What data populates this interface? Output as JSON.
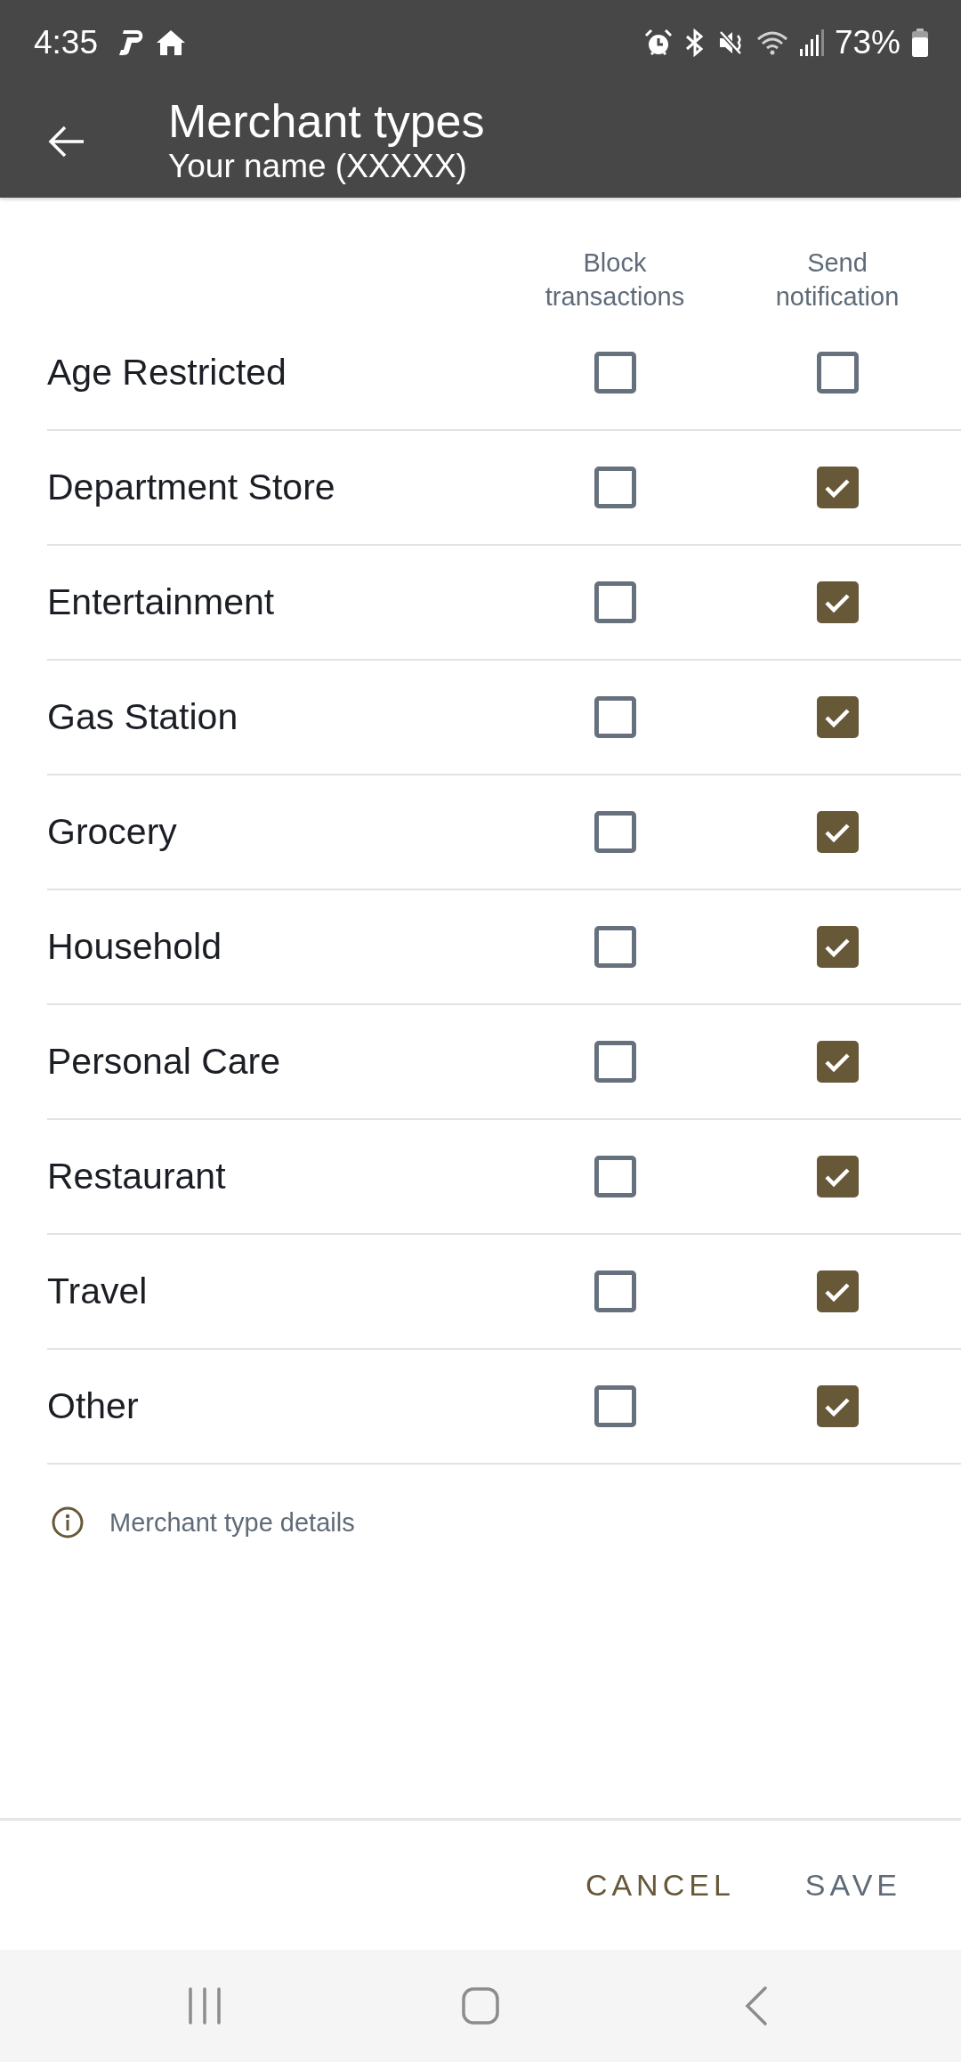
{
  "status_bar": {
    "time": "4:35",
    "battery": "73%"
  },
  "app_bar": {
    "title": "Merchant types",
    "subtitle": "Your name (XXXXX)"
  },
  "columns": [
    "Block transactions",
    "Send notification"
  ],
  "rows": [
    {
      "label": "Age Restricted",
      "block_checked": false,
      "notify_checked": false
    },
    {
      "label": "Department Store",
      "block_checked": false,
      "notify_checked": true
    },
    {
      "label": "Entertainment",
      "block_checked": false,
      "notify_checked": true
    },
    {
      "label": "Gas Station",
      "block_checked": false,
      "notify_checked": true
    },
    {
      "label": "Grocery",
      "block_checked": false,
      "notify_checked": true
    },
    {
      "label": "Household",
      "block_checked": false,
      "notify_checked": true
    },
    {
      "label": "Personal Care",
      "block_checked": false,
      "notify_checked": true
    },
    {
      "label": "Restaurant",
      "block_checked": false,
      "notify_checked": true
    },
    {
      "label": "Travel",
      "block_checked": false,
      "notify_checked": true
    },
    {
      "label": "Other",
      "block_checked": false,
      "notify_checked": true
    }
  ],
  "details_link": "Merchant type details",
  "buttons": [
    {
      "label": "CANCEL",
      "disabled": false
    },
    {
      "label": "SAVE",
      "disabled": true
    }
  ]
}
